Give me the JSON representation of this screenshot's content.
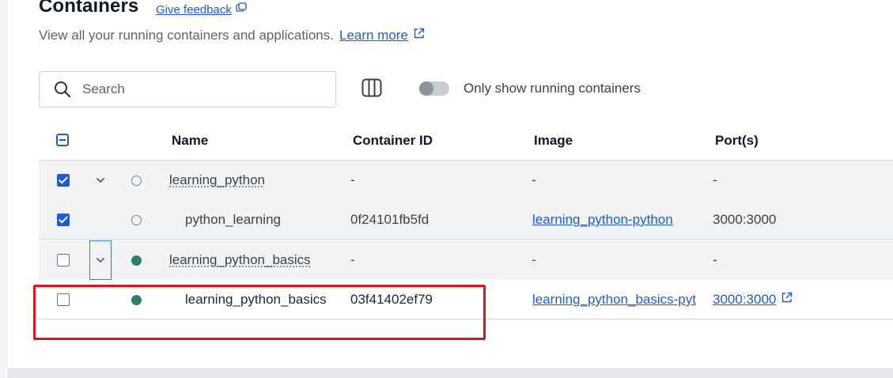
{
  "header": {
    "title": "Containers",
    "feedback_label": "Give feedback",
    "subtitle": "View all your running containers and applications.",
    "learn_more_label": "Learn more"
  },
  "toolbar": {
    "search_placeholder": "Search",
    "search_value": "",
    "toggle_label": "Only show running containers",
    "toggle_on": false
  },
  "table": {
    "columns": [
      "Name",
      "Container ID",
      "Image",
      "Port(s)"
    ],
    "rows": [
      {
        "name": "learning_python",
        "container_id": "-",
        "image": "-",
        "ports": "-",
        "checked": true,
        "status": "stopped",
        "group": true
      },
      {
        "name": "python_learning",
        "container_id": "0f24101fb5fd",
        "image": "learning_python-python",
        "ports": "3000:3000",
        "checked": true,
        "status": "stopped",
        "group": false
      },
      {
        "name": "learning_python_basics",
        "container_id": "-",
        "image": "-",
        "ports": "-",
        "checked": false,
        "status": "running",
        "group": true
      },
      {
        "name": "learning_python_basics",
        "container_id": "03f41402ef79",
        "image": "learning_python_basics-pyt",
        "ports": "3000:3000",
        "checked": false,
        "status": "running",
        "group": false
      }
    ]
  },
  "colors": {
    "accent": "#1f5bd6",
    "running": "#2d7d6b",
    "highlight": "#e4131a"
  }
}
